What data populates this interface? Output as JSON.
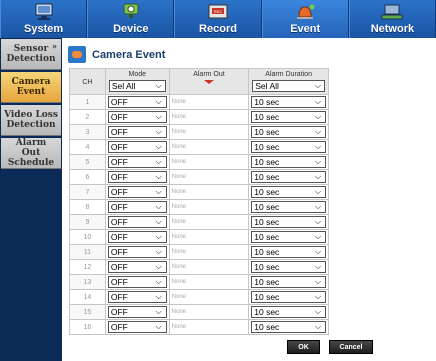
{
  "topnav": {
    "tabs": [
      {
        "label": "System",
        "icon": "monitor-icon",
        "active": false
      },
      {
        "label": "Device",
        "icon": "camera-icon",
        "active": false
      },
      {
        "label": "Record",
        "icon": "record-icon",
        "active": false
      },
      {
        "label": "Event",
        "icon": "alarm-bell-icon",
        "active": true
      },
      {
        "label": "Network",
        "icon": "network-icon",
        "active": false
      }
    ]
  },
  "sidebar": {
    "items": [
      {
        "label": "Sensor Detection",
        "active": false
      },
      {
        "label": "Camera Event",
        "active": true
      },
      {
        "label": "Video Loss Detection",
        "active": false
      },
      {
        "label": "Alarm Out Schedule",
        "active": false
      }
    ]
  },
  "page": {
    "title": "Camera Event",
    "columns": {
      "ch": "CH",
      "mode": "Mode",
      "alarm_out": "Alarm Out",
      "alarm_duration": "Alarm Duration"
    },
    "header_selects": {
      "mode": "Sel All",
      "alarm_duration": "Sel All"
    },
    "rows": [
      {
        "ch": "1",
        "mode": "OFF",
        "alarm_out": "None",
        "duration": "10 sec"
      },
      {
        "ch": "2",
        "mode": "OFF",
        "alarm_out": "None",
        "duration": "10 sec"
      },
      {
        "ch": "3",
        "mode": "OFF",
        "alarm_out": "None",
        "duration": "10 sec"
      },
      {
        "ch": "4",
        "mode": "OFF",
        "alarm_out": "None",
        "duration": "10 sec"
      },
      {
        "ch": "5",
        "mode": "OFF",
        "alarm_out": "None",
        "duration": "10 sec"
      },
      {
        "ch": "6",
        "mode": "OFF",
        "alarm_out": "None",
        "duration": "10 sec"
      },
      {
        "ch": "7",
        "mode": "OFF",
        "alarm_out": "None",
        "duration": "10 sec"
      },
      {
        "ch": "8",
        "mode": "OFF",
        "alarm_out": "None",
        "duration": "10 sec"
      },
      {
        "ch": "9",
        "mode": "OFF",
        "alarm_out": "None",
        "duration": "10 sec"
      },
      {
        "ch": "10",
        "mode": "OFF",
        "alarm_out": "None",
        "duration": "10 sec"
      },
      {
        "ch": "11",
        "mode": "OFF",
        "alarm_out": "None",
        "duration": "10 sec"
      },
      {
        "ch": "12",
        "mode": "OFF",
        "alarm_out": "None",
        "duration": "10 sec"
      },
      {
        "ch": "13",
        "mode": "OFF",
        "alarm_out": "None",
        "duration": "10 sec"
      },
      {
        "ch": "14",
        "mode": "OFF",
        "alarm_out": "None",
        "duration": "10 sec"
      },
      {
        "ch": "15",
        "mode": "OFF",
        "alarm_out": "None",
        "duration": "10 sec"
      },
      {
        "ch": "16",
        "mode": "OFF",
        "alarm_out": "None",
        "duration": "10 sec"
      }
    ]
  },
  "buttons": {
    "ok": "OK",
    "cancel": "Cancel"
  },
  "colors": {
    "topbar": "#1f5fb0",
    "sidebar": "#0b2a55",
    "active_side": "#e6a63d",
    "button": "#2a2a2a"
  }
}
